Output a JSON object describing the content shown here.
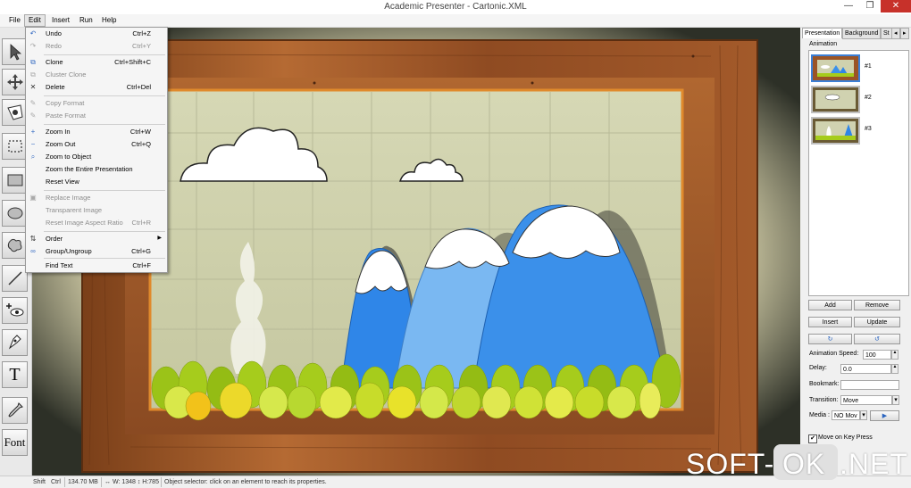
{
  "window": {
    "title": "Academic Presenter - Cartonic.XML",
    "minimize_glyph": "—",
    "maximize_glyph": "❐",
    "close_glyph": "✕"
  },
  "menubar": {
    "items": [
      "File",
      "Edit",
      "Insert",
      "Run",
      "Help"
    ],
    "active": "Edit"
  },
  "edit_menu": {
    "items": [
      {
        "label": "Undo",
        "shortcut": "Ctrl+Z",
        "icon": "undo-icon",
        "glyph": "↶",
        "enabled": true
      },
      {
        "label": "Redo",
        "shortcut": "Ctrl+Y",
        "icon": "redo-icon",
        "glyph": "↷",
        "enabled": false
      },
      {
        "label": "Clone",
        "shortcut": "Ctrl+Shift+C",
        "icon": "clone-icon",
        "glyph": "⧉",
        "enabled": true
      },
      {
        "label": "Cluster Clone",
        "shortcut": "",
        "icon": "cluster-clone-icon",
        "glyph": "⧉",
        "enabled": false
      },
      {
        "label": "Delete",
        "shortcut": "Ctrl+Del",
        "icon": "delete-icon",
        "glyph": "✕",
        "enabled": true
      },
      {
        "label": "Copy Format",
        "shortcut": "",
        "icon": "copy-format-icon",
        "glyph": "✎",
        "enabled": false
      },
      {
        "label": "Paste Format",
        "shortcut": "",
        "icon": "paste-format-icon",
        "glyph": "✎",
        "enabled": false
      },
      {
        "label": "Zoom In",
        "shortcut": "Ctrl+W",
        "icon": "zoom-in-icon",
        "glyph": "+",
        "enabled": true
      },
      {
        "label": "Zoom Out",
        "shortcut": "Ctrl+Q",
        "icon": "zoom-out-icon",
        "glyph": "−",
        "enabled": true
      },
      {
        "label": "Zoom to Object",
        "shortcut": "",
        "icon": "zoom-object-icon",
        "glyph": "⌕",
        "enabled": true
      },
      {
        "label": "Zoom the Entire Presentation",
        "shortcut": "",
        "icon": "",
        "glyph": "",
        "enabled": true
      },
      {
        "label": "Reset View",
        "shortcut": "",
        "icon": "",
        "glyph": "",
        "enabled": true
      },
      {
        "label": "Replace Image",
        "shortcut": "",
        "icon": "replace-image-icon",
        "glyph": "▣",
        "enabled": false
      },
      {
        "label": "Transparent Image",
        "shortcut": "",
        "icon": "",
        "glyph": "",
        "enabled": false
      },
      {
        "label": "Reset Image Aspect Ratio",
        "shortcut": "Ctrl+R",
        "icon": "",
        "glyph": "",
        "enabled": false
      },
      {
        "label": "Order",
        "shortcut": "",
        "icon": "order-icon",
        "glyph": "⇅",
        "enabled": true,
        "submenu": true
      },
      {
        "label": "Group/Ungroup",
        "shortcut": "Ctrl+G",
        "icon": "group-icon",
        "glyph": "∞",
        "enabled": true
      },
      {
        "label": "Find Text",
        "shortcut": "Ctrl+F",
        "icon": "",
        "glyph": "",
        "enabled": true
      }
    ],
    "submenu_glyph": "▶"
  },
  "toolbar": {
    "tools": [
      {
        "name": "select-arrow-tool",
        "icon": "arrow-cursor-icon"
      },
      {
        "name": "move-tool",
        "icon": "move-arrows-icon"
      },
      {
        "name": "camera-tool",
        "icon": "camera-view-icon"
      },
      {
        "name": "frame-select-tool",
        "icon": "dashed-rect-icon"
      },
      {
        "name": "rectangle-tool",
        "icon": "rectangle-icon"
      },
      {
        "name": "ellipse-tool",
        "icon": "ellipse-icon"
      },
      {
        "name": "freeform-tool",
        "icon": "freeform-shape-icon"
      },
      {
        "name": "line-tool",
        "icon": "line-icon"
      },
      {
        "name": "add-view-tool",
        "icon": "eye-plus-icon"
      },
      {
        "name": "pen-tool",
        "icon": "pen-icon"
      },
      {
        "name": "text-tool",
        "icon": "text-icon",
        "label": "T"
      },
      {
        "name": "eyedropper-tool",
        "icon": "eyedropper-icon"
      },
      {
        "name": "font-tool",
        "icon": "font-icon",
        "label": "Font"
      }
    ]
  },
  "right_panel": {
    "tabs": [
      "Presentation",
      "Background",
      "St"
    ],
    "tab_nav": [
      "◂",
      "▸"
    ],
    "active_tab": "Presentation",
    "animation_label": "Animation",
    "slides": [
      "#1",
      "#2",
      "#3"
    ],
    "buttons": {
      "add": "Add",
      "remove": "Remove",
      "insert": "Insert",
      "update": "Update",
      "rotate_left_glyph": "↻",
      "rotate_right_glyph": "↺"
    },
    "fields": {
      "animation_speed_label": "Animation Speed:",
      "animation_speed_value": "100",
      "delay_label": "Delay:",
      "delay_value": "0.0",
      "bookmark_label": "Bookmark:",
      "bookmark_value": "",
      "transition_label": "Transition:",
      "transition_value": "Move",
      "media_label": "Media :",
      "media_value": "NO Mov",
      "play_glyph": "▶",
      "spin_up_glyph": "▲",
      "spin_down_glyph": "▼",
      "dropdown_glyph": "▾"
    },
    "move_on_key_press_label": "Move on Key Press",
    "move_on_key_press_checked": true,
    "checkbox_glyph": "✔"
  },
  "status": {
    "shift": "Shift",
    "ctrl": "Ctrl",
    "memory": "134.70 MB",
    "size": "↔ W: 1348 ↕ H:785",
    "message": "Object selector: click on an element to reach its properties."
  },
  "watermark": {
    "left": "SOFT-",
    "mid": "OK",
    "right": ".NET"
  },
  "colors": {
    "close_button": "#c7312a",
    "selection_blue": "#3c7fd6",
    "wood": "#a0582a",
    "mountain_blue": "#2f86e8"
  }
}
